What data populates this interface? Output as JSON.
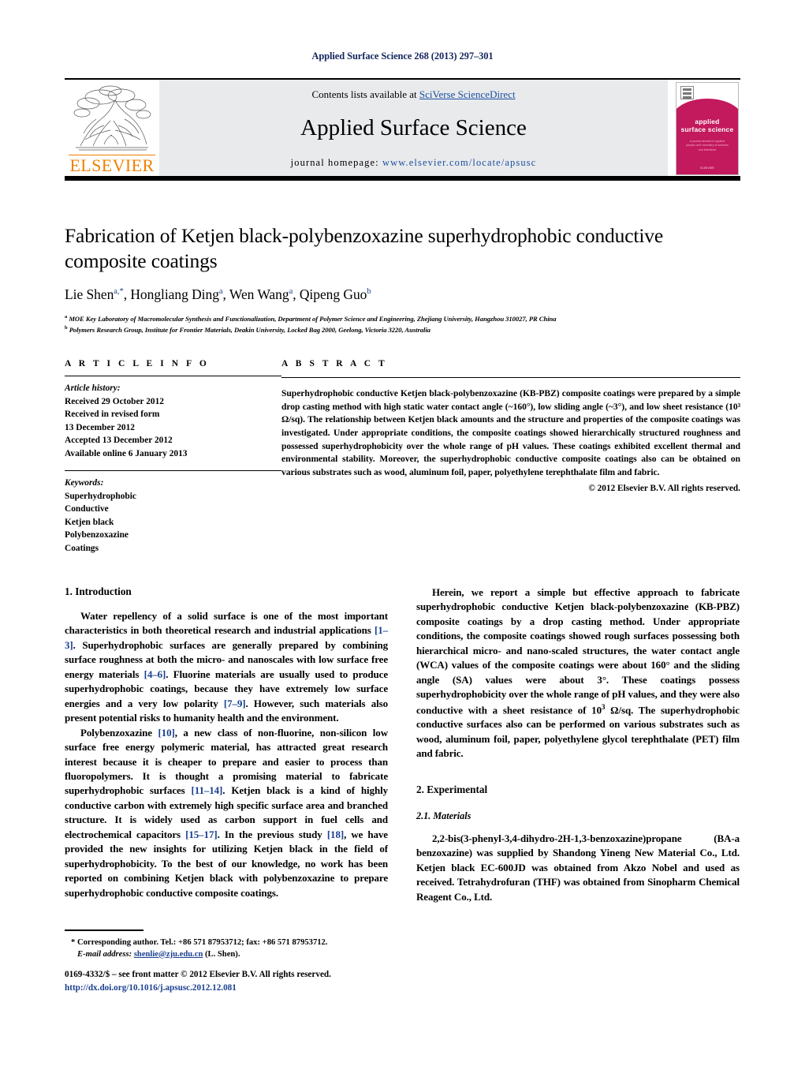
{
  "running_head": "Applied Surface Science 268 (2013) 297–301",
  "masthead": {
    "contents_prefix": "Contents lists available at ",
    "contents_link": "SciVerse ScienceDirect",
    "journal_name": "Applied Surface Science",
    "homepage_label": "journal homepage:",
    "homepage_url": "www.elsevier.com/locate/apsusc",
    "publisher_wordmark": "ELSEVIER",
    "cover": {
      "title_line1": "applied",
      "title_line2": "surface science",
      "subtitle": "a journal devoted to applied physics and chemistry of surfaces and interfaces",
      "footer": "ELSEVIER"
    }
  },
  "article": {
    "title": "Fabrication of Ketjen black-polybenzoxazine superhydrophobic conductive composite coatings",
    "authors": [
      {
        "name": "Lie Shen",
        "marks": "a,*"
      },
      {
        "name": "Hongliang Ding",
        "marks": "a"
      },
      {
        "name": "Wen Wang",
        "marks": "a"
      },
      {
        "name": "Qipeng Guo",
        "marks": "b"
      }
    ],
    "affiliations": [
      {
        "mark": "a",
        "text": "MOE Key Laboratory of Macromolecular Synthesis and Functionalization, Department of Polymer Science and Engineering, Zhejiang University, Hangzhou 310027, PR China"
      },
      {
        "mark": "b",
        "text": "Polymers Research Group, Institute for Frontier Materials, Deakin University, Locked Bag 2000, Geelong, Victoria 3220, Australia"
      }
    ]
  },
  "article_info": {
    "heading": "A R T I C L E   I N F O",
    "history_label": "Article history:",
    "history": [
      "Received 29 October 2012",
      "Received in revised form",
      "13 December 2012",
      "Accepted 13 December 2012",
      "Available online 6 January 2013"
    ],
    "keywords_label": "Keywords:",
    "keywords": [
      "Superhydrophobic",
      "Conductive",
      "Ketjen black",
      "Polybenzoxazine",
      "Coatings"
    ]
  },
  "abstract": {
    "heading": "A B S T R A C T",
    "text": "Superhydrophobic conductive Ketjen black-polybenzoxazine (KB-PBZ) composite coatings were prepared by a simple drop casting method with high static water contact angle (~160°), low sliding angle (~3°), and low sheet resistance (10³ Ω/sq). The relationship between Ketjen black amounts and the structure and properties of the composite coatings was investigated. Under appropriate conditions, the composite coatings showed hierarchically structured roughness and possessed superhydrophobicity over the whole range of pH values. These coatings exhibited excellent thermal and environmental stability. Moreover, the superhydrophobic conductive composite coatings also can be obtained on various substrates such as wood, aluminum foil, paper, polyethylene terephthalate film and fabric.",
    "copyright": "© 2012 Elsevier B.V. All rights reserved."
  },
  "sections": {
    "intro_heading": "1.  Introduction",
    "intro_p1_a": "Water repellency of a solid surface is one of the most important characteristics in both theoretical research and industrial applications ",
    "intro_p1_ref1": "[1–3]",
    "intro_p1_b": ". Superhydrophobic surfaces are generally prepared by combining surface roughness at both the micro- and nanoscales with low surface free energy materials ",
    "intro_p1_ref2": "[4–6]",
    "intro_p1_c": ". Fluorine materials are usually used to produce superhydrophobic coatings, because they have extremely low surface energies and a very low polarity ",
    "intro_p1_ref3": "[7–9]",
    "intro_p1_d": ". However, such materials also present potential risks to humanity health and the environment.",
    "intro_p2_a": "Polybenzoxazine ",
    "intro_p2_ref1": "[10]",
    "intro_p2_b": ", a new class of non-fluorine, non-silicon low surface free energy polymeric material, has attracted great research interest because it is cheaper to prepare and easier to process than fluoropolymers. It is thought a promising material to fabricate superhydrophobic surfaces ",
    "intro_p2_ref2": "[11–14]",
    "intro_p2_c": ". Ketjen black is a kind of highly conductive carbon with extremely high specific surface area and branched structure. It is widely used as carbon support in fuel cells and electrochemical capacitors ",
    "intro_p2_ref3": "[15–17]",
    "intro_p2_d": ". In the previous study ",
    "intro_p2_ref4": "[18]",
    "intro_p2_e": ", we have provided the new insights for utilizing Ketjen black in the field of superhydrophobicity. To the best of our knowledge, no work has been reported on combining Ketjen black with polybenzoxazine to prepare superhydrophobic conductive composite coatings.",
    "intro_p3_a": "Herein, we report a simple but effective approach to fabricate superhydrophobic conductive Ketjen black-polybenzoxazine (KB-PBZ) composite coatings by a drop casting method. Under appropriate conditions, the composite coatings showed rough surfaces possessing both hierarchical micro- and nano-scaled structures, the water contact angle (WCA) values of the composite coatings were about 160° and the sliding angle (SA) values were about 3°. These coatings possess superhydrophobicity over the whole range of pH values, and they were also conductive with a sheet resistance of 10",
    "intro_p3_sup": "3",
    "intro_p3_b": " Ω/sq. The superhydrophobic conductive surfaces also can be performed on various substrates such as wood, aluminum foil, paper, polyethylene glycol terephthalate (PET) film and fabric.",
    "exp_heading": "2.  Experimental",
    "materials_heading": "2.1.  Materials",
    "materials_p1": "2,2-bis(3-phenyl-3,4-dihydro-2H-1,3-benzoxazine)propane (BA-a benzoxazine) was supplied by Shandong Yineng New Material Co., Ltd. Ketjen black EC-600JD was obtained from Akzo Nobel and used as received. Tetrahydrofuran (THF) was obtained from Sinopharm Chemical Reagent Co., Ltd."
  },
  "footnote": {
    "star": "*",
    "corresponding": " Corresponding author. Tel.: +86 571 87953712; fax: +86 571 87953712.",
    "email_label": "E-mail address:",
    "email": "shenlie@zju.edu.cn",
    "email_suffix": " (L. Shen)."
  },
  "imprint": {
    "issn_line": "0169-4332/$ – see front matter © 2012 Elsevier B.V. All rights reserved.",
    "doi_line": "http://dx.doi.org/10.1016/j.apsusc.2012.12.081"
  },
  "colors": {
    "running_head": "#14265c",
    "link_blue": "#1a4fa0",
    "ref_blue": "#1a3f8f",
    "elsevier_orange": "#F08000",
    "masthead_grey": "#e9eaec",
    "cover_magenta": "#c3195d"
  }
}
